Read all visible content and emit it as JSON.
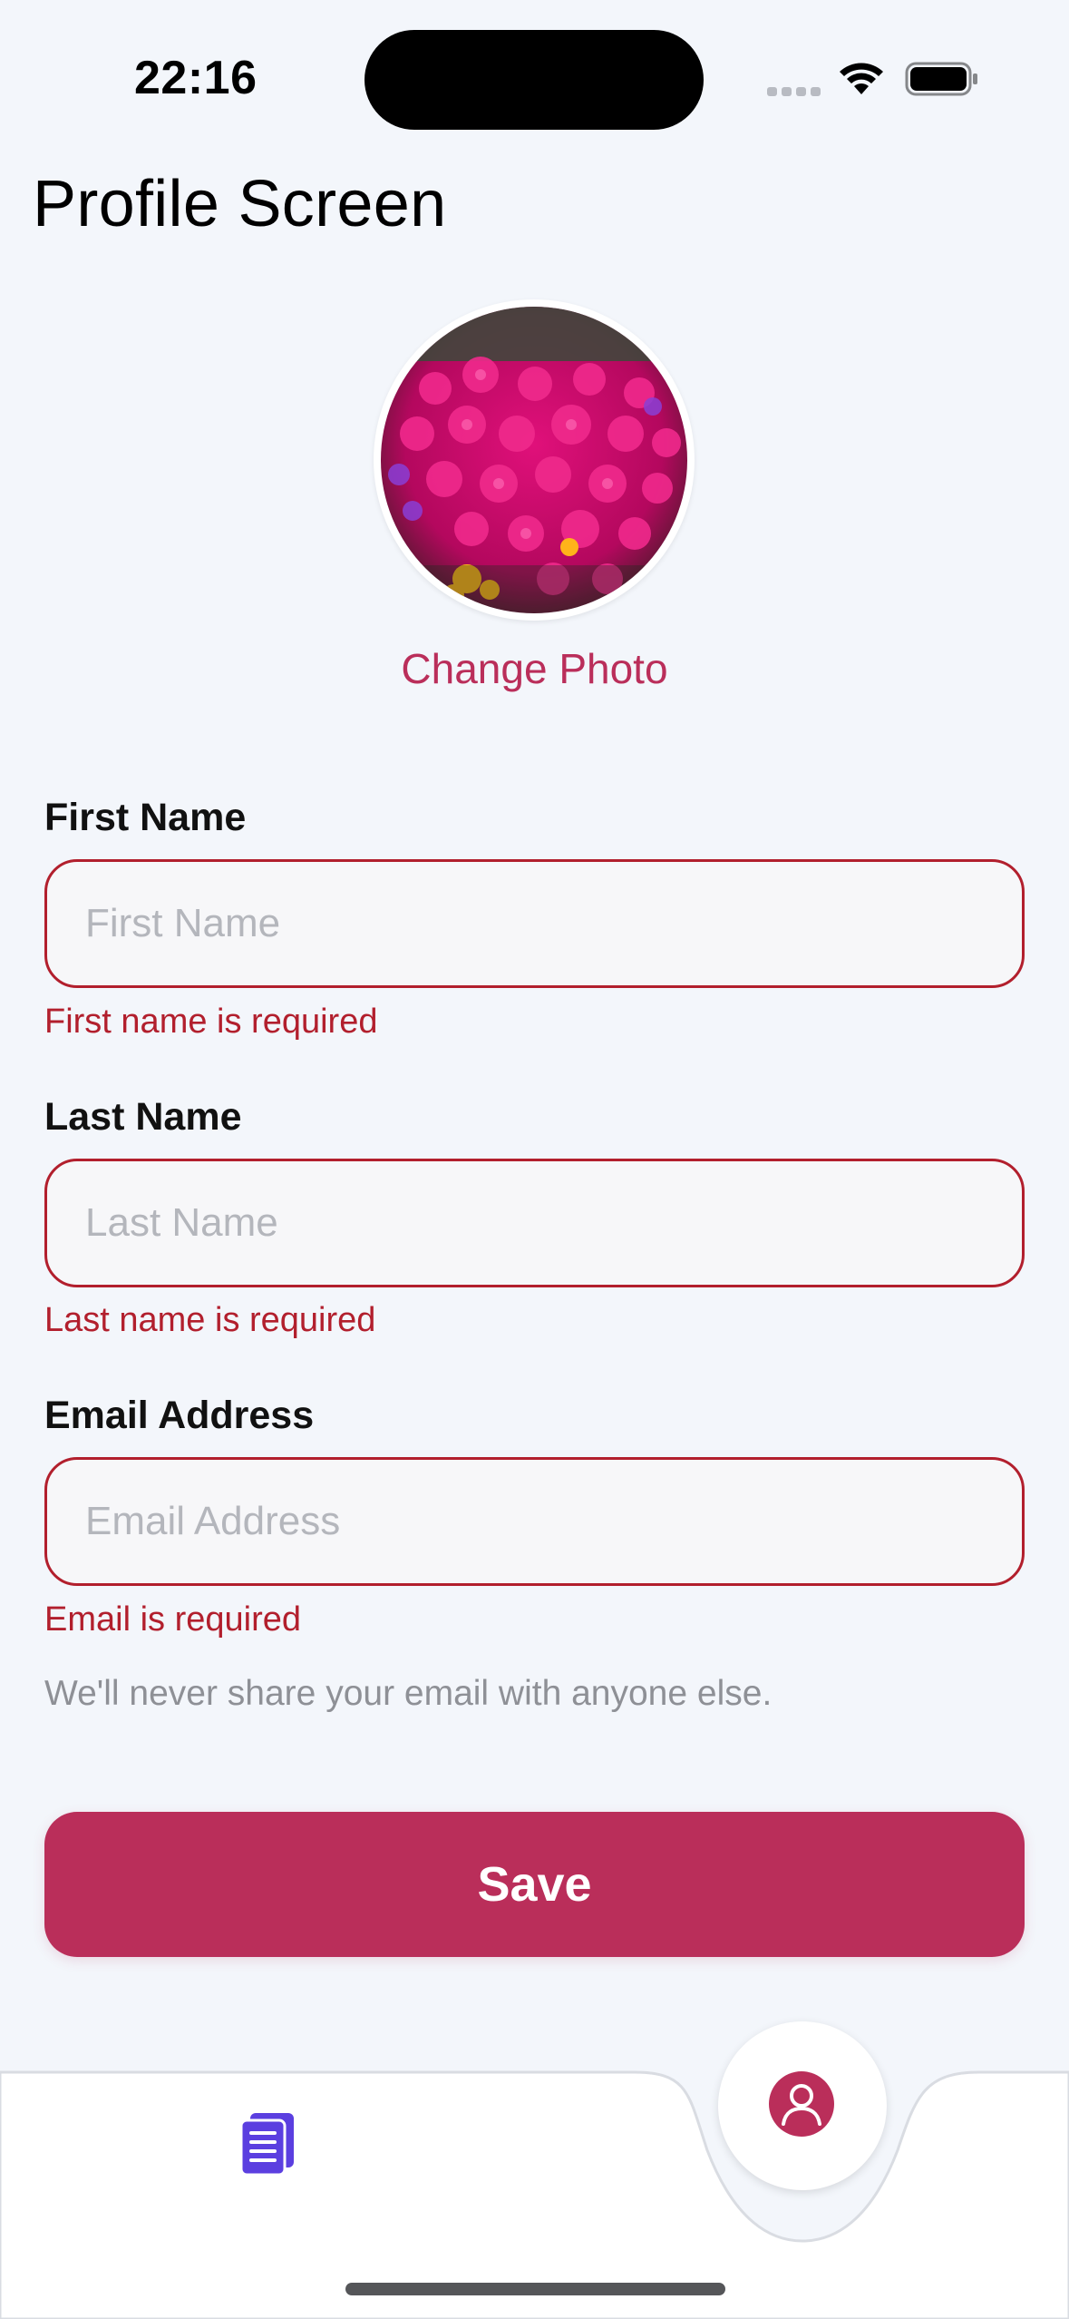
{
  "status_bar": {
    "time": "22:16"
  },
  "page": {
    "title": "Profile Screen"
  },
  "avatar": {
    "change_photo_label": "Change Photo"
  },
  "form": {
    "first_name": {
      "label": "First Name",
      "placeholder": "First Name",
      "value": "",
      "error": "First name is required"
    },
    "last_name": {
      "label": "Last Name",
      "placeholder": "Last Name",
      "value": "",
      "error": "Last name is required"
    },
    "email": {
      "label": "Email Address",
      "placeholder": "Email Address",
      "value": "",
      "error": "Email is required",
      "help": "We'll never share your email with anyone else."
    },
    "save_label": "Save"
  },
  "tab_bar": {
    "tabs": [
      {
        "icon": "document-list-icon",
        "active": false
      },
      {
        "icon": "user-icon",
        "active": true
      }
    ]
  },
  "colors": {
    "accent": "#BA2E5A",
    "error": "#B21F2D",
    "background": "#F3F6FB",
    "tab_docs_icon": "#5B3FE0"
  }
}
